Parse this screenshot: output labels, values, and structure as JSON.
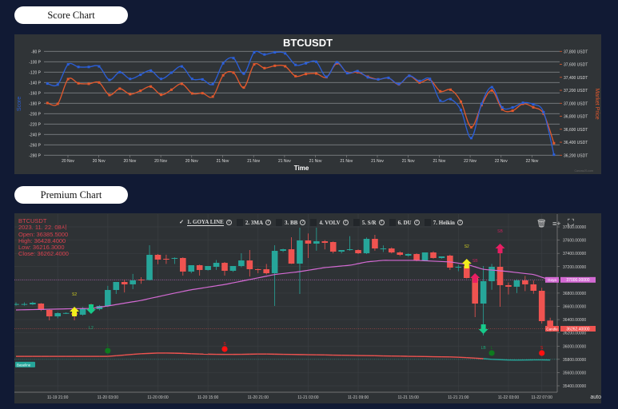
{
  "tabs": {
    "score_chart": "Score Chart",
    "premium_chart": "Premium Chart"
  },
  "score_chart": {
    "title": "BTCUSDT",
    "xlabel": "Time",
    "ylabel_left": "Score",
    "ylabel_right": "Market Price",
    "watermark": "CanvasJS.com",
    "colors": {
      "score": "#2b5fd9",
      "price": "#e2582c",
      "background": "#303437"
    },
    "left_ticks": [
      "-80 P",
      "-100 P",
      "-120 P",
      "-140 P",
      "-160 P",
      "-180 P",
      "-200 P",
      "-220 P",
      "-240 P",
      "-260 P",
      "-280 P"
    ],
    "right_ticks": [
      "37,800 USDT",
      "37,600 USDT",
      "37,400 USDT",
      "37,200 USDT",
      "37,000 USDT",
      "36,800 USDT",
      "36,600 USDT",
      "36,400 USDT",
      "36,200 USDT"
    ],
    "x_ticks": [
      "20 Nov",
      "20 Nov",
      "20 Nov",
      "20 Nov",
      "20 Nov",
      "21 Nov",
      "21 Nov",
      "21 Nov",
      "21 Nov",
      "21 Nov",
      "21 Nov",
      "21 Nov",
      "21 Nov",
      "22 Nov",
      "22 Nov",
      "22 Nov"
    ]
  },
  "chart_data": [
    {
      "type": "line",
      "title": "BTCUSDT",
      "xlabel": "Time",
      "ylabel": "Score",
      "ylabel_right": "Market Price",
      "ylim": [
        -280,
        -80
      ],
      "ylim_right": [
        36200,
        37800
      ],
      "grid": true,
      "series": [
        {
          "axis": "left",
          "color": "#2b5fd9",
          "values": [
            -142,
            -144,
            -105,
            -110,
            -110,
            -109,
            -135,
            -120,
            -133,
            -125,
            -117,
            -133,
            -121,
            -109,
            -133,
            -134,
            -143,
            -103,
            -93,
            -123,
            -82,
            -86,
            -82,
            -84,
            -106,
            -103,
            -100,
            -129,
            -101,
            -122,
            -118,
            -130,
            -134,
            -131,
            -143,
            -127,
            -137,
            -133,
            -175,
            -172,
            -193,
            -247,
            -181,
            -149,
            -188,
            -188,
            -179,
            -182,
            -197,
            -279
          ]
        },
        {
          "axis": "right",
          "color": "#e2582c",
          "values": [
            37004,
            36992,
            37373,
            37308,
            37300,
            37320,
            37127,
            37226,
            37140,
            37193,
            37258,
            37131,
            37209,
            37300,
            37152,
            37156,
            37103,
            37431,
            37472,
            37242,
            37599,
            37542,
            37578,
            37570,
            37418,
            37451,
            37459,
            37402,
            37615,
            37472,
            37480,
            37410,
            37369,
            37390,
            37291,
            37423,
            37320,
            37365,
            37185,
            37209,
            37025,
            36631,
            36971,
            37197,
            36906,
            36885,
            36992,
            36938,
            36840,
            36385
          ]
        }
      ]
    },
    {
      "type": "candlestick",
      "ylim": [
        35400,
        37800
      ],
      "grid": true,
      "y_ticks": [
        "37800.00000",
        "37600.00000",
        "37400.00000",
        "37200.00000",
        "37000.00000",
        "36800.00000",
        "36600.00000",
        "36400.00000",
        "36200.00000",
        "36000.00000",
        "35800.00000",
        "35600.00000",
        "35400.00000"
      ],
      "x_ticks": [
        "11-19 21:00",
        "11-20 03:00",
        "11-20 09:00",
        "11-20 15:00",
        "11-20 21:00",
        "11-21 03:00",
        "11-21 09:00",
        "11-21 15:00",
        "11-21 21:00",
        "11-22 03:00",
        "11-22 07:00"
      ],
      "colors": {
        "up": "#26a69a",
        "down": "#ef5350",
        "goya": "#d36ad3",
        "baseline": "#26a69a"
      },
      "candles_ohlc": [
        [
          36625,
          36660,
          36610,
          36635
        ],
        [
          36625,
          36660,
          36610,
          36635
        ],
        [
          36630,
          36670,
          36620,
          36654
        ],
        [
          36642,
          36650,
          36530,
          36546
        ],
        [
          36546,
          36560,
          36389,
          36449
        ],
        [
          36449,
          36510,
          36420,
          36498
        ],
        [
          36498,
          36510,
          36485,
          36500
        ],
        [
          36498,
          36505,
          36389,
          36474
        ],
        [
          36474,
          36590,
          36460,
          36570
        ],
        [
          36570,
          36640,
          36520,
          36558
        ],
        [
          36558,
          36620,
          36540,
          36606
        ],
        [
          36606,
          36910,
          36590,
          36847
        ],
        [
          36847,
          36968,
          36787,
          36968
        ],
        [
          36968,
          37004,
          36810,
          36932
        ],
        [
          36932,
          37090,
          36860,
          36992
        ],
        [
          37004,
          37040,
          36940,
          36998
        ],
        [
          36998,
          37523,
          36990,
          37378
        ],
        [
          37378,
          37390,
          37236,
          37306
        ],
        [
          37318,
          37380,
          37240,
          37310
        ],
        [
          37320,
          37340,
          37240,
          37330
        ],
        [
          37330,
          37340,
          37064,
          37125
        ],
        [
          37125,
          37150,
          37100,
          37221
        ],
        [
          37221,
          37230,
          37064,
          37149
        ],
        [
          37149,
          37170,
          37140,
          37209
        ],
        [
          37197,
          37300,
          37150,
          37257
        ],
        [
          37257,
          37270,
          37064,
          37137
        ],
        [
          37137,
          37150,
          37120,
          37209
        ],
        [
          37209,
          37402,
          37190,
          37293
        ],
        [
          37293,
          37450,
          37050,
          37161
        ],
        [
          37161,
          37170,
          37100,
          37155
        ],
        [
          37161,
          37240,
          37080,
          37100
        ],
        [
          37100,
          37523,
          36606,
          37438
        ],
        [
          37438,
          37470,
          37420,
          37462
        ],
        [
          37462,
          37643,
          37240,
          37245
        ],
        [
          37245,
          37788,
          36787,
          37595
        ],
        [
          37595,
          37700,
          37330,
          37547
        ],
        [
          37547,
          37788,
          37440,
          37583
        ],
        [
          37583,
          37600,
          37460,
          37559
        ],
        [
          37571,
          37580,
          37400,
          37426
        ],
        [
          37426,
          37440,
          37400,
          37450
        ],
        [
          37450,
          37660,
          37440,
          37462
        ],
        [
          37450,
          37460,
          37390,
          37402
        ],
        [
          37402,
          37640,
          37390,
          37619
        ],
        [
          37619,
          37680,
          37440,
          37474
        ],
        [
          37470,
          37520,
          37420,
          37474
        ],
        [
          37474,
          37490,
          37400,
          37414
        ],
        [
          37414,
          37430,
          37360,
          37378
        ],
        [
          37366,
          37400,
          37350,
          37390
        ],
        [
          37390,
          37400,
          37280,
          37293
        ],
        [
          37293,
          37310,
          37280,
          37414
        ],
        [
          37414,
          37430,
          37320,
          37330
        ],
        [
          37330,
          37340,
          37320,
          37354
        ],
        [
          37366,
          37380,
          37150,
          37185
        ],
        [
          37190,
          37230,
          37130,
          37197
        ],
        [
          37209,
          37220,
          37020,
          37028
        ],
        [
          37028,
          37040,
          36437,
          36642
        ],
        [
          36642,
          37209,
          36160,
          36980
        ],
        [
          36980,
          37240,
          36850,
          37197
        ],
        [
          37197,
          37523,
          36594,
          36920
        ],
        [
          36920,
          36960,
          36780,
          36896
        ],
        [
          36896,
          37010,
          36800,
          36992
        ],
        [
          36992,
          37060,
          36830,
          36932
        ],
        [
          36932,
          36990,
          36790,
          36835
        ],
        [
          36835,
          36880,
          36340,
          36377
        ],
        [
          36385.5,
          36428.4,
          36216.3,
          36262.4
        ]
      ],
      "goya_line": [
        36546,
        36549,
        36551,
        36554,
        36557,
        36559,
        36562,
        36565,
        36567,
        36570,
        36588,
        36606,
        36627,
        36648,
        36669,
        36690,
        36718,
        36745,
        36773,
        36800,
        36825,
        36850,
        36870,
        36890,
        36910,
        36930,
        36955,
        36980,
        37005,
        37030,
        37055,
        37080,
        37095,
        37110,
        37125,
        37145,
        37165,
        37185,
        37197,
        37209,
        37221,
        37245,
        37270,
        37282,
        37294,
        37294,
        37294,
        37294,
        37294,
        37288,
        37282,
        37276,
        37270,
        37252,
        37233,
        37197,
        37160,
        37148,
        37137,
        37125,
        37110,
        37095,
        37080,
        37040,
        37000
      ],
      "lower_line": [
        35845,
        35845,
        35845,
        35845,
        35845,
        35845,
        35845,
        35845,
        35845,
        35845,
        35845,
        35845,
        35855,
        35865,
        35875,
        35885,
        35890,
        35895,
        35895,
        35893,
        35890,
        35885,
        35880,
        35878,
        35876,
        35875,
        35875,
        35876,
        35878,
        35880,
        35880,
        35878,
        35876,
        35874,
        35872,
        35870,
        35868,
        35866,
        35864,
        35862,
        35860,
        35858,
        35856,
        35854,
        35852,
        35850,
        35848,
        35846,
        35844,
        35842,
        35840,
        35838,
        35836,
        35832,
        35826,
        35818,
        35810,
        35800,
        35795,
        35790,
        35788,
        35790,
        35792,
        35792,
        35790
      ],
      "baseline": 35800,
      "signals": [
        {
          "label": "S2",
          "dir": "down",
          "candle": 8,
          "price": 36594,
          "color": "#f2ee1c"
        },
        {
          "label": "L2",
          "dir": "up",
          "candle": 10,
          "price": 36486,
          "color": "#17c98a"
        },
        {
          "label": "S2",
          "dir": "down",
          "candle": 55,
          "price": 37318,
          "color": "#f2ee1c"
        },
        {
          "label": "SB",
          "dir": "down",
          "candle": 56,
          "price": 37100,
          "color": "#e91e63"
        },
        {
          "label": "SB",
          "dir": "down",
          "candle": 59,
          "price": 37547,
          "color": "#e91e63"
        },
        {
          "label": "LB",
          "dir": "up",
          "candle": 57,
          "price": 36184,
          "color": "#17c98a"
        }
      ],
      "dots": [
        {
          "label": "L",
          "candle": 12,
          "price": 35930,
          "color": "#0e7a1e"
        },
        {
          "label": "S",
          "candle": 26,
          "price": 35955,
          "color": "#ff1010"
        },
        {
          "label": "L",
          "candle": 58,
          "price": 35895,
          "color": "#0e7a1e"
        },
        {
          "label": "S",
          "candle": 64,
          "price": 35895,
          "color": "#ff1010"
        }
      ]
    }
  ],
  "premium_chart": {
    "legend": {
      "symbol": "BTCUSDT",
      "datetime": "2023. 11. 22. 08시",
      "open": "Open: 36385.5000",
      "high": "High: 36428.4000",
      "low": "Low: 36216.3000",
      "close": "Close: 36262.4000"
    },
    "indicators": [
      {
        "label": "1. GOYA LINE",
        "checked": true,
        "check": "✓"
      },
      {
        "label": "2. 3MA",
        "checked": false
      },
      {
        "label": "3. BB",
        "checked": false
      },
      {
        "label": "4. VOLV",
        "checked": false
      },
      {
        "label": "5. S/R",
        "checked": false
      },
      {
        "label": "6. DU",
        "checked": false
      },
      {
        "label": "7. Heikin",
        "checked": false
      }
    ],
    "info_glyph": "?",
    "icons": [
      "trash-icon",
      "add-list-icon",
      "fullscreen-icon"
    ],
    "goya_tag": {
      "name": "Goya",
      "value": "37000.00000"
    },
    "candle_tag": {
      "name": "Candle",
      "value": "36262.40000"
    },
    "baseline_tag": "Baseline",
    "scale_mode": "auto"
  }
}
